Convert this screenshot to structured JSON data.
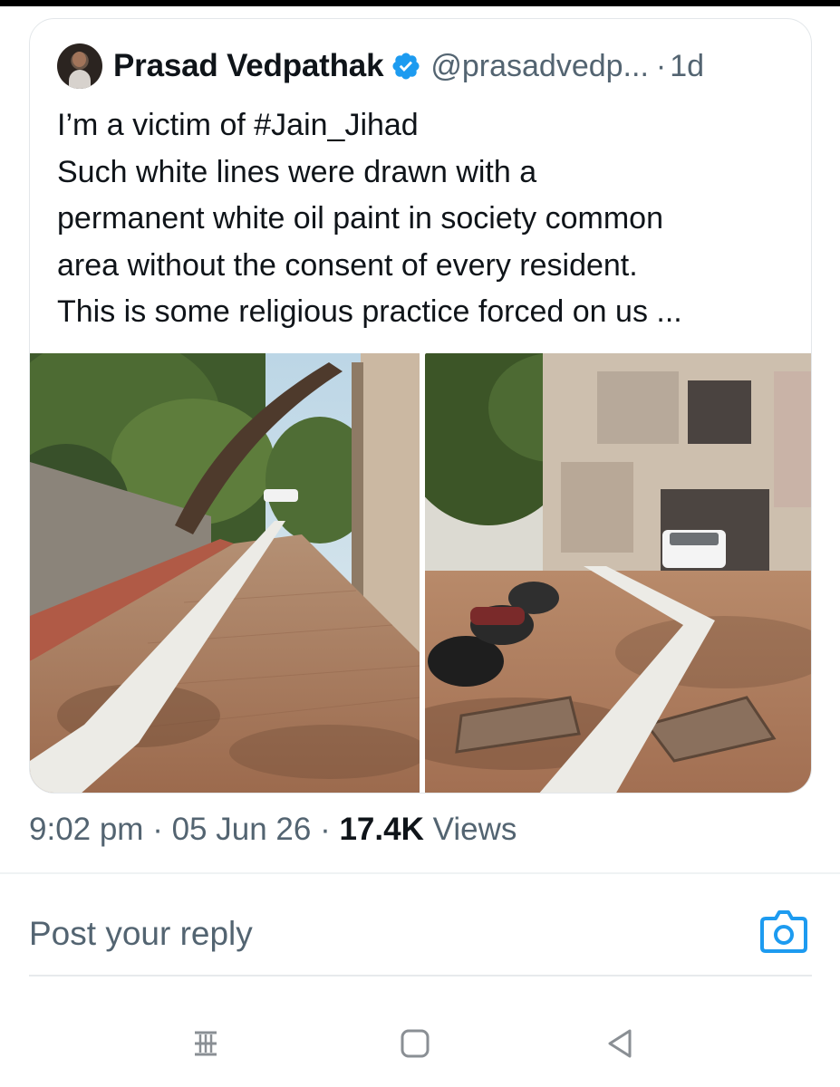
{
  "tweet": {
    "author_name": "Prasad Vedpathak",
    "handle": "@prasadvedp...",
    "separator": "·",
    "time_ago": "1d",
    "text_lines": [
      "I’m a victim of #Jain_Jihad",
      "Such white lines were drawn with a",
      "permanent white oil paint in society common",
      "area without the consent of every resident.",
      "This is some religious practice forced on us ..."
    ],
    "meta": {
      "time": "9:02 pm",
      "dot": "·",
      "date": "05 Jun 26",
      "views_count": "17.4K",
      "views_label": "Views"
    }
  },
  "reply": {
    "placeholder": "Post your reply"
  },
  "icons": {
    "verified": "verified-badge-icon",
    "camera": "camera-icon",
    "recent_apps": "recent-apps-icon",
    "home": "home-icon",
    "back": "back-icon"
  },
  "colors": {
    "verified_blue": "#1d9bf0",
    "secondary_text": "#536471",
    "primary_text": "#0f1419",
    "camera_blue": "#1d9bf0"
  }
}
